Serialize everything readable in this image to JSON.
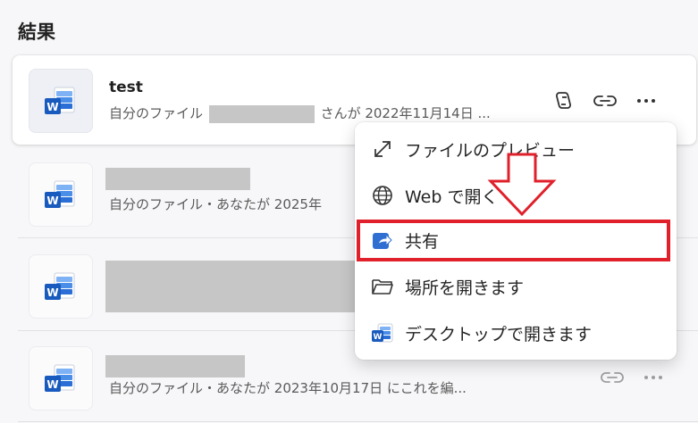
{
  "page": {
    "title": "結果"
  },
  "files": [
    {
      "name": "test",
      "sub_prefix": "自分のファイル",
      "sub_suffix": "さんが 2022年11月14日 ..."
    },
    {
      "name": "",
      "sub": "自分のファイル・あなたが 2025年"
    },
    {
      "name": "",
      "sub": ""
    },
    {
      "name": "",
      "sub": "自分のファイル・あなたが 2023年10月17日 にこれを編..."
    }
  ],
  "menu": {
    "items": [
      {
        "label": "ファイルのプレビュー",
        "icon": "expand-icon"
      },
      {
        "label": "Web で開く",
        "icon": "globe-icon"
      },
      {
        "label": "共有",
        "icon": "share-icon"
      },
      {
        "label": "場所を開きます",
        "icon": "folder-icon"
      },
      {
        "label": "デスクトップで開きます",
        "icon": "word-icon"
      }
    ]
  },
  "colors": {
    "highlight": "#e0202a",
    "word_blue": "#185abd",
    "selected_row_bg": "#ffffff"
  }
}
